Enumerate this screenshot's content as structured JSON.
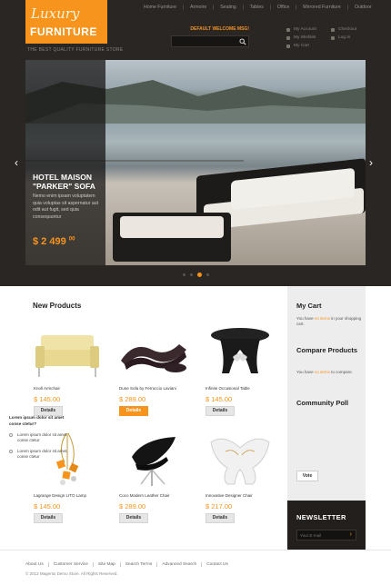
{
  "logo": {
    "script": "Luxury",
    "word": "FURNITURE"
  },
  "tagline": "THE BEST QUALITY FURNITURE STORE",
  "nav": [
    "Home Furniture",
    "Armoire",
    "Seating",
    "Tables",
    "Office",
    "Mirrored Furniture",
    "Outdoor"
  ],
  "welcome": "DEFAULT WELCOME MSG!",
  "search": {
    "placeholder": ""
  },
  "account_left": [
    "My Account",
    "My Wishlist",
    "My Cart"
  ],
  "account_right": [
    "Checkout",
    "Log In"
  ],
  "slide": {
    "title": "HOTEL MAISON \"PARKER\" SOFA",
    "desc": "Nemo enim ipsam voluptatem quia voluptas sit aspernatur aut odit aut fugit, sed quia consequuntur",
    "price": "$ 2 499",
    "cents": "00",
    "prev": "‹",
    "next": "›"
  },
  "new_products": {
    "title": "New Products",
    "items": [
      {
        "name": "Knoll Armchair",
        "price": "$ 145.00",
        "button": "Details"
      },
      {
        "name": "Dune Sofa by Ferruccio Laviani",
        "price": "$ 289.00",
        "button": "Details"
      },
      {
        "name": "Infinite Occasional Table",
        "price": "$ 145.00",
        "button": "Details"
      },
      {
        "name": "Lagrange Design LITO Lamp",
        "price": "$ 145.00",
        "button": "Details"
      },
      {
        "name": "Coco Modern Leather Chair",
        "price": "$ 289.00",
        "button": "Details"
      },
      {
        "name": "Innovative Designer Chair",
        "price": "$ 217.00",
        "button": "Details"
      }
    ]
  },
  "sidebar": {
    "cart_title": "My Cart",
    "cart_pre": "You have",
    "cart_bold": "no items",
    "cart_post": "in your shopping cart.",
    "compare_title": "Compare Products",
    "compare_pre": "You have",
    "compare_bold": "no items",
    "compare_post": "to compare.",
    "poll_title": "Community Poll",
    "poll_question": "Lorem ipsum dolor sit amet conse ctetur?",
    "poll_options": [
      "Lorem ipsum dolor sit amet conse ctetur",
      "Lorem ipsum dolor sit amet, conse ctetur"
    ],
    "vote": "Vote"
  },
  "newsletter": {
    "title": "NEWSLETTER",
    "placeholder": "Your E-mail",
    "go": "›"
  },
  "footer": {
    "links": [
      "About Us",
      "Customer Service",
      "Site Map",
      "Search Terms",
      "Advanced Search",
      "Contact Us"
    ],
    "copyright": "© 2012 Magento Demo Store. All Rights Reserved."
  },
  "colors": {
    "accent": "#f7941d",
    "dark": "#2a2624"
  }
}
